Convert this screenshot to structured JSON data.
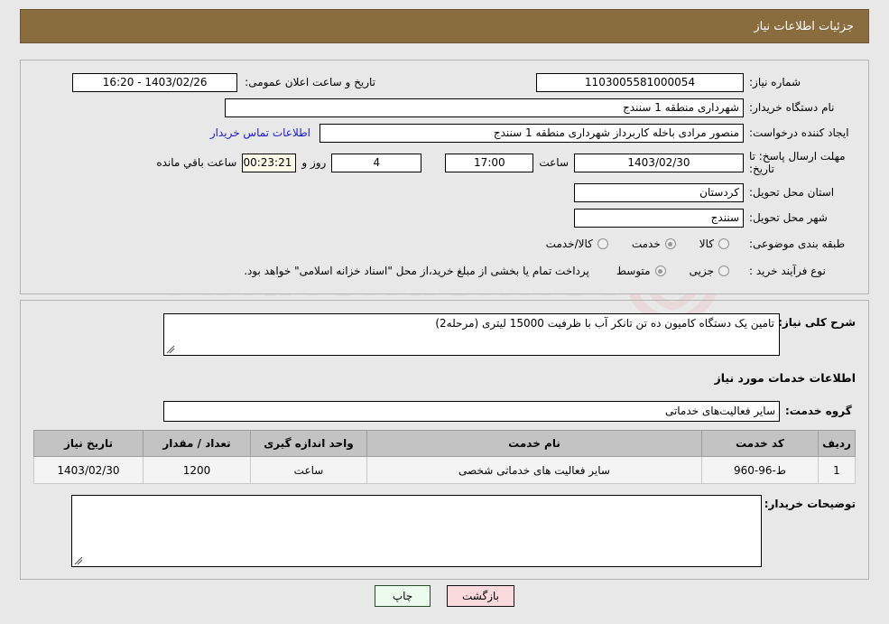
{
  "header": {
    "title": "جزئیات اطلاعات نیاز",
    "bar_color": "#8a6d3f"
  },
  "watermark": {
    "text": "AriaTender.net"
  },
  "top_panel": {
    "need_number_label": "شماره نیاز:",
    "need_number_value": "1103005581000054",
    "announce_label": "تاریخ و ساعت اعلان عمومی:",
    "announce_value": "1403/02/26 - 16:20",
    "buyer_org_label": "نام دستگاه خریدار:",
    "buyer_org_value": "شهرداری منطقه 1 سنندج",
    "creator_label": "ایجاد کننده درخواست:",
    "creator_value": "منصور مرادی باخله کاربرداز شهرداری منطقه 1 سنندج",
    "contact_link": "اطلاعات تماس خریدار",
    "deadline_label": "مهلت ارسال پاسخ: تا تاریخ:",
    "deadline_date": "1403/02/30",
    "hour_label": "ساعت",
    "deadline_time": "17:00",
    "days_value": "4",
    "days_label": "روز و",
    "countdown_value": "00:23:21",
    "countdown_label": "ساعت باقي مانده",
    "province_label": "استان محل تحویل:",
    "province_value": "کردستان",
    "city_label": "شهر محل تحویل:",
    "city_value": "سنندج",
    "category_label": "طبقه بندی موضوعی:",
    "category_options": [
      {
        "label": "کالا",
        "selected": false
      },
      {
        "label": "خدمت",
        "selected": true
      },
      {
        "label": "کالا/خدمت",
        "selected": false
      }
    ],
    "process_label": "نوع فرآیند خرید :",
    "process_options": [
      {
        "label": "جزیی",
        "selected": false
      },
      {
        "label": "متوسط",
        "selected": true
      }
    ],
    "process_note": "پرداخت تمام یا بخشی از مبلغ خرید،از محل \"اسناد خزانه اسلامی\" خواهد بود."
  },
  "mid_panel": {
    "summary_label": "شرح کلی نیاز:",
    "summary_value": "تامین یک دستگاه کامیون ده تن تانکر آب با ظرفیت 15000 لیتری (مرحله2)",
    "services_heading": "اطلاعات خدمات مورد نیاز",
    "service_group_label": "گروه خدمت:",
    "service_group_value": "سایر فعالیت‌های خدماتی",
    "table": {
      "columns": [
        "ردیف",
        "کد خدمت",
        "نام خدمت",
        "واحد اندازه گیری",
        "تعداد / مقدار",
        "تاریخ نیاز"
      ],
      "rows": [
        [
          "1",
          "ط-96-960",
          "سایر فعالیت های خدماتی شخصی",
          "ساعت",
          "1200",
          "1403/02/30"
        ]
      ]
    },
    "buyer_notes_label": "توضیحات خریدار:",
    "buyer_notes_value": ""
  },
  "buttons": {
    "back": "بازگشت",
    "print": "چاپ"
  }
}
